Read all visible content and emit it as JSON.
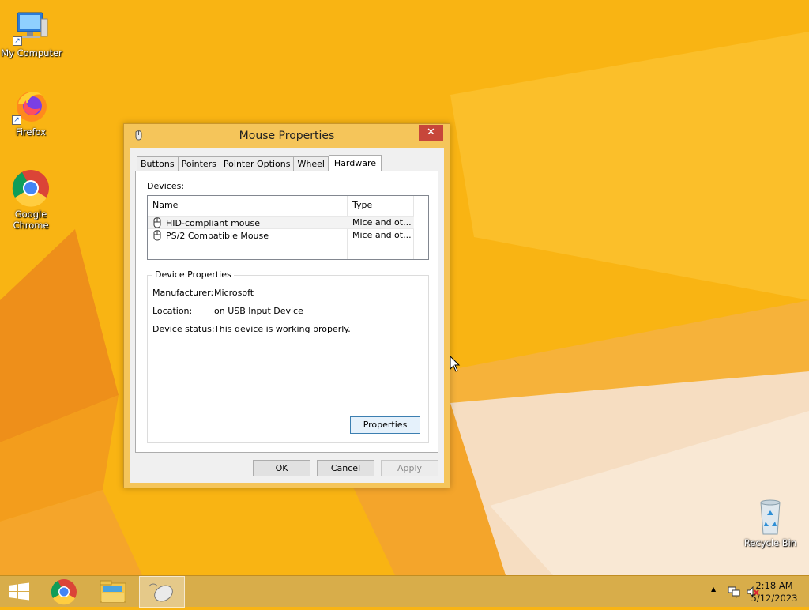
{
  "desktop": {
    "icons": [
      {
        "name": "my-computer",
        "label": "My Computer"
      },
      {
        "name": "firefox",
        "label": "Firefox"
      },
      {
        "name": "google-chrome",
        "label": "Google Chrome"
      },
      {
        "name": "recycle-bin",
        "label": "Recycle Bin"
      }
    ]
  },
  "dialog": {
    "title": "Mouse Properties",
    "close_symbol": "✕",
    "tabs": [
      "Buttons",
      "Pointers",
      "Pointer Options",
      "Wheel",
      "Hardware"
    ],
    "active_tab": "Hardware",
    "devices_label": "Devices:",
    "devices_columns": [
      "Name",
      "Type"
    ],
    "devices": [
      {
        "name": "HID-compliant mouse",
        "type": "Mice and ot..."
      },
      {
        "name": "PS/2 Compatible Mouse",
        "type": "Mice and ot..."
      }
    ],
    "device_properties": {
      "legend": "Device Properties",
      "manufacturer_label": "Manufacturer:",
      "manufacturer": "Microsoft",
      "location_label": "Location:",
      "location": "on USB Input Device",
      "status_label": "Device status:",
      "status": "This device is working properly.",
      "properties_button": "Properties"
    },
    "buttons": {
      "ok": "OK",
      "cancel": "Cancel",
      "apply": "Apply"
    }
  },
  "taskbar": {
    "clock_time": "2:18 AM",
    "clock_date": "5/12/2023",
    "tray_arrow": "▲"
  },
  "colors": {
    "wallpaper": "#f9b413",
    "dialog_frame": "#f5c55a",
    "close_button": "#c7463a",
    "taskbar": "#d8ad4a"
  }
}
